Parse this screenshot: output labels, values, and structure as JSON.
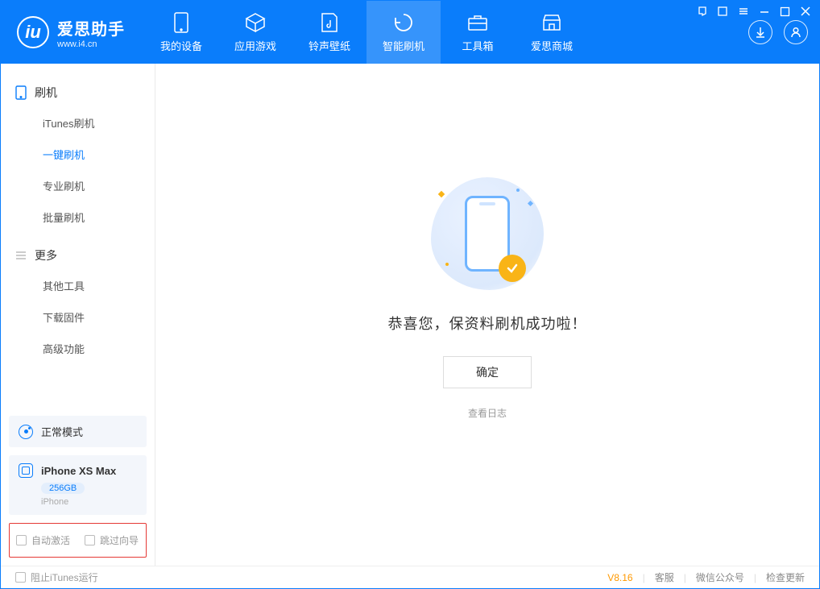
{
  "app": {
    "title": "爱思助手",
    "url": "www.i4.cn"
  },
  "nav": {
    "device": "我的设备",
    "apps": "应用游戏",
    "ringtone": "铃声壁纸",
    "flash": "智能刷机",
    "tools": "工具箱",
    "store": "爱思商城"
  },
  "sidebar": {
    "cat_flash": "刷机",
    "items_flash": {
      "itunes": "iTunes刷机",
      "oneclick": "一键刷机",
      "pro": "专业刷机",
      "batch": "批量刷机"
    },
    "cat_more": "更多",
    "items_more": {
      "other": "其他工具",
      "firmware": "下载固件",
      "advanced": "高级功能"
    },
    "mode": "正常模式",
    "device": {
      "name": "iPhone XS Max",
      "capacity": "256GB",
      "type": "iPhone"
    },
    "options": {
      "auto_activate": "自动激活",
      "skip_guide": "跳过向导"
    }
  },
  "main": {
    "success": "恭喜您，保资料刷机成功啦！",
    "ok": "确定",
    "log": "查看日志"
  },
  "footer": {
    "block_itunes": "阻止iTunes运行",
    "version": "V8.16",
    "support": "客服",
    "wechat": "微信公众号",
    "update": "检查更新"
  }
}
